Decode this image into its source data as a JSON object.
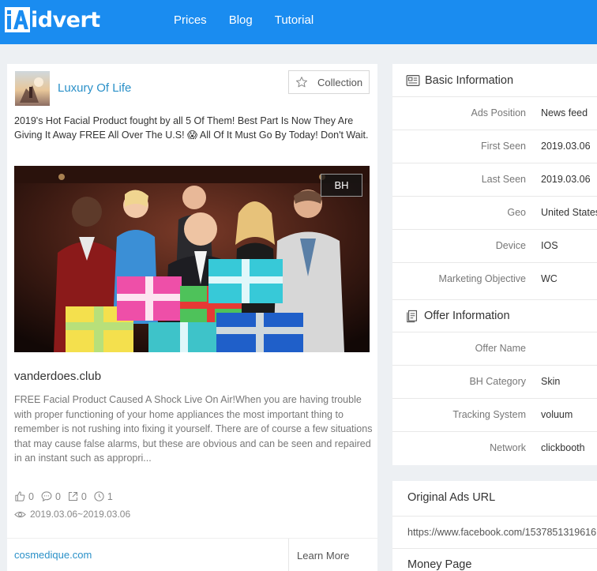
{
  "header": {
    "logo_letters": "iA",
    "logo_text": "idvert",
    "nav": [
      "Prices",
      "Blog",
      "Tutorial"
    ],
    "color": "#1a8cf0"
  },
  "ad": {
    "advertiser": "Luxury Of Life",
    "collection_label": "Collection",
    "text": "2019's Hot Facial Product fought by all 5 Of Them! Best Part Is Now They Are Giving It Away FREE All Over The U.S! 😱 All Of It Must Go By Today! Don't Wait.",
    "badge": "BH",
    "domain": "vanderdoes.club",
    "description": "FREE Facial Product Caused A Shock Live On Air!When you are having trouble with proper functioning of your home appliances the most important thing to remember is not rushing into fixing it yourself. There are of course a few situations that may cause false alarms, but these are obvious and can be seen and repaired in an instant such as appropri...",
    "stats": {
      "likes": "0",
      "comments": "0",
      "shares": "0",
      "time": "1"
    },
    "date_range": "2019.03.06~2019.03.06",
    "footer_link": "cosmedique.com",
    "cta": "Learn More"
  },
  "basic_info": {
    "title": "Basic Information",
    "rows": [
      {
        "label": "Ads Position",
        "value": "News feed"
      },
      {
        "label": "First Seen",
        "value": "2019.03.06"
      },
      {
        "label": "Last Seen",
        "value": "2019.03.06"
      },
      {
        "label": "Geo",
        "value": "United States"
      },
      {
        "label": "Device",
        "value": "IOS"
      },
      {
        "label": "Marketing Objective",
        "value": "WC"
      }
    ]
  },
  "offer_info": {
    "title": "Offer Information",
    "rows": [
      {
        "label": "Offer Name",
        "value": ""
      },
      {
        "label": "BH Category",
        "value": "Skin"
      },
      {
        "label": "Tracking System",
        "value": "voluum"
      },
      {
        "label": "Network",
        "value": "clickbooth"
      }
    ]
  },
  "original_url": {
    "title": "Original Ads URL",
    "value": "https://www.facebook.com/1537851319616"
  },
  "money_page": {
    "title": "Money Page"
  }
}
